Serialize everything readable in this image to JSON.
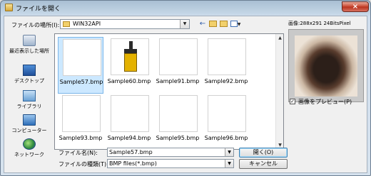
{
  "window": {
    "title": "ファイルを開く",
    "close_label": "×"
  },
  "toolbar": {
    "look_in_label": "ファイルの場所(I):",
    "look_in_value": "WIN32API",
    "back_icon": "←"
  },
  "places": [
    {
      "label": "最近表示した場所",
      "icon": "recent-places-icon"
    },
    {
      "label": "デスクトップ",
      "icon": "desktop-icon"
    },
    {
      "label": "ライブラリ",
      "icon": "libraries-icon"
    },
    {
      "label": "コンピューター",
      "icon": "computer-icon"
    },
    {
      "label": "ネットワーク",
      "icon": "network-icon"
    }
  ],
  "files": [
    {
      "name": "Sample57.bmp",
      "thumb": "rabbit",
      "selected": true
    },
    {
      "name": "Sample60.bmp",
      "thumb": "brush",
      "selected": false
    },
    {
      "name": "Sample91.bmp",
      "thumb": "landscape",
      "selected": false
    },
    {
      "name": "Sample92.bmp",
      "thumb": "landscape",
      "selected": false
    },
    {
      "name": "Sample93.bmp",
      "thumb": "landscape",
      "selected": false
    },
    {
      "name": "Sample94.bmp",
      "thumb": "landscape",
      "selected": false
    },
    {
      "name": "Sample95.bmp",
      "thumb": "landscape",
      "selected": false
    },
    {
      "name": "Sample96.bmp",
      "thumb": "landscape",
      "selected": false
    }
  ],
  "filename": {
    "label": "ファイル名(N):",
    "value": "Sample57.bmp"
  },
  "filetype": {
    "label": "ファイルの種類(T):",
    "value": "BMP files(*.bmp)"
  },
  "buttons": {
    "open": "開く(O)",
    "cancel": "キャンセル"
  },
  "preview": {
    "info": "画像:288x291 24BitsPixel",
    "checkbox_label": "画像をプレビュー(P)",
    "checked": true
  },
  "colors": {
    "selection": "#cce8ff",
    "accent": "#3c7fb1"
  }
}
